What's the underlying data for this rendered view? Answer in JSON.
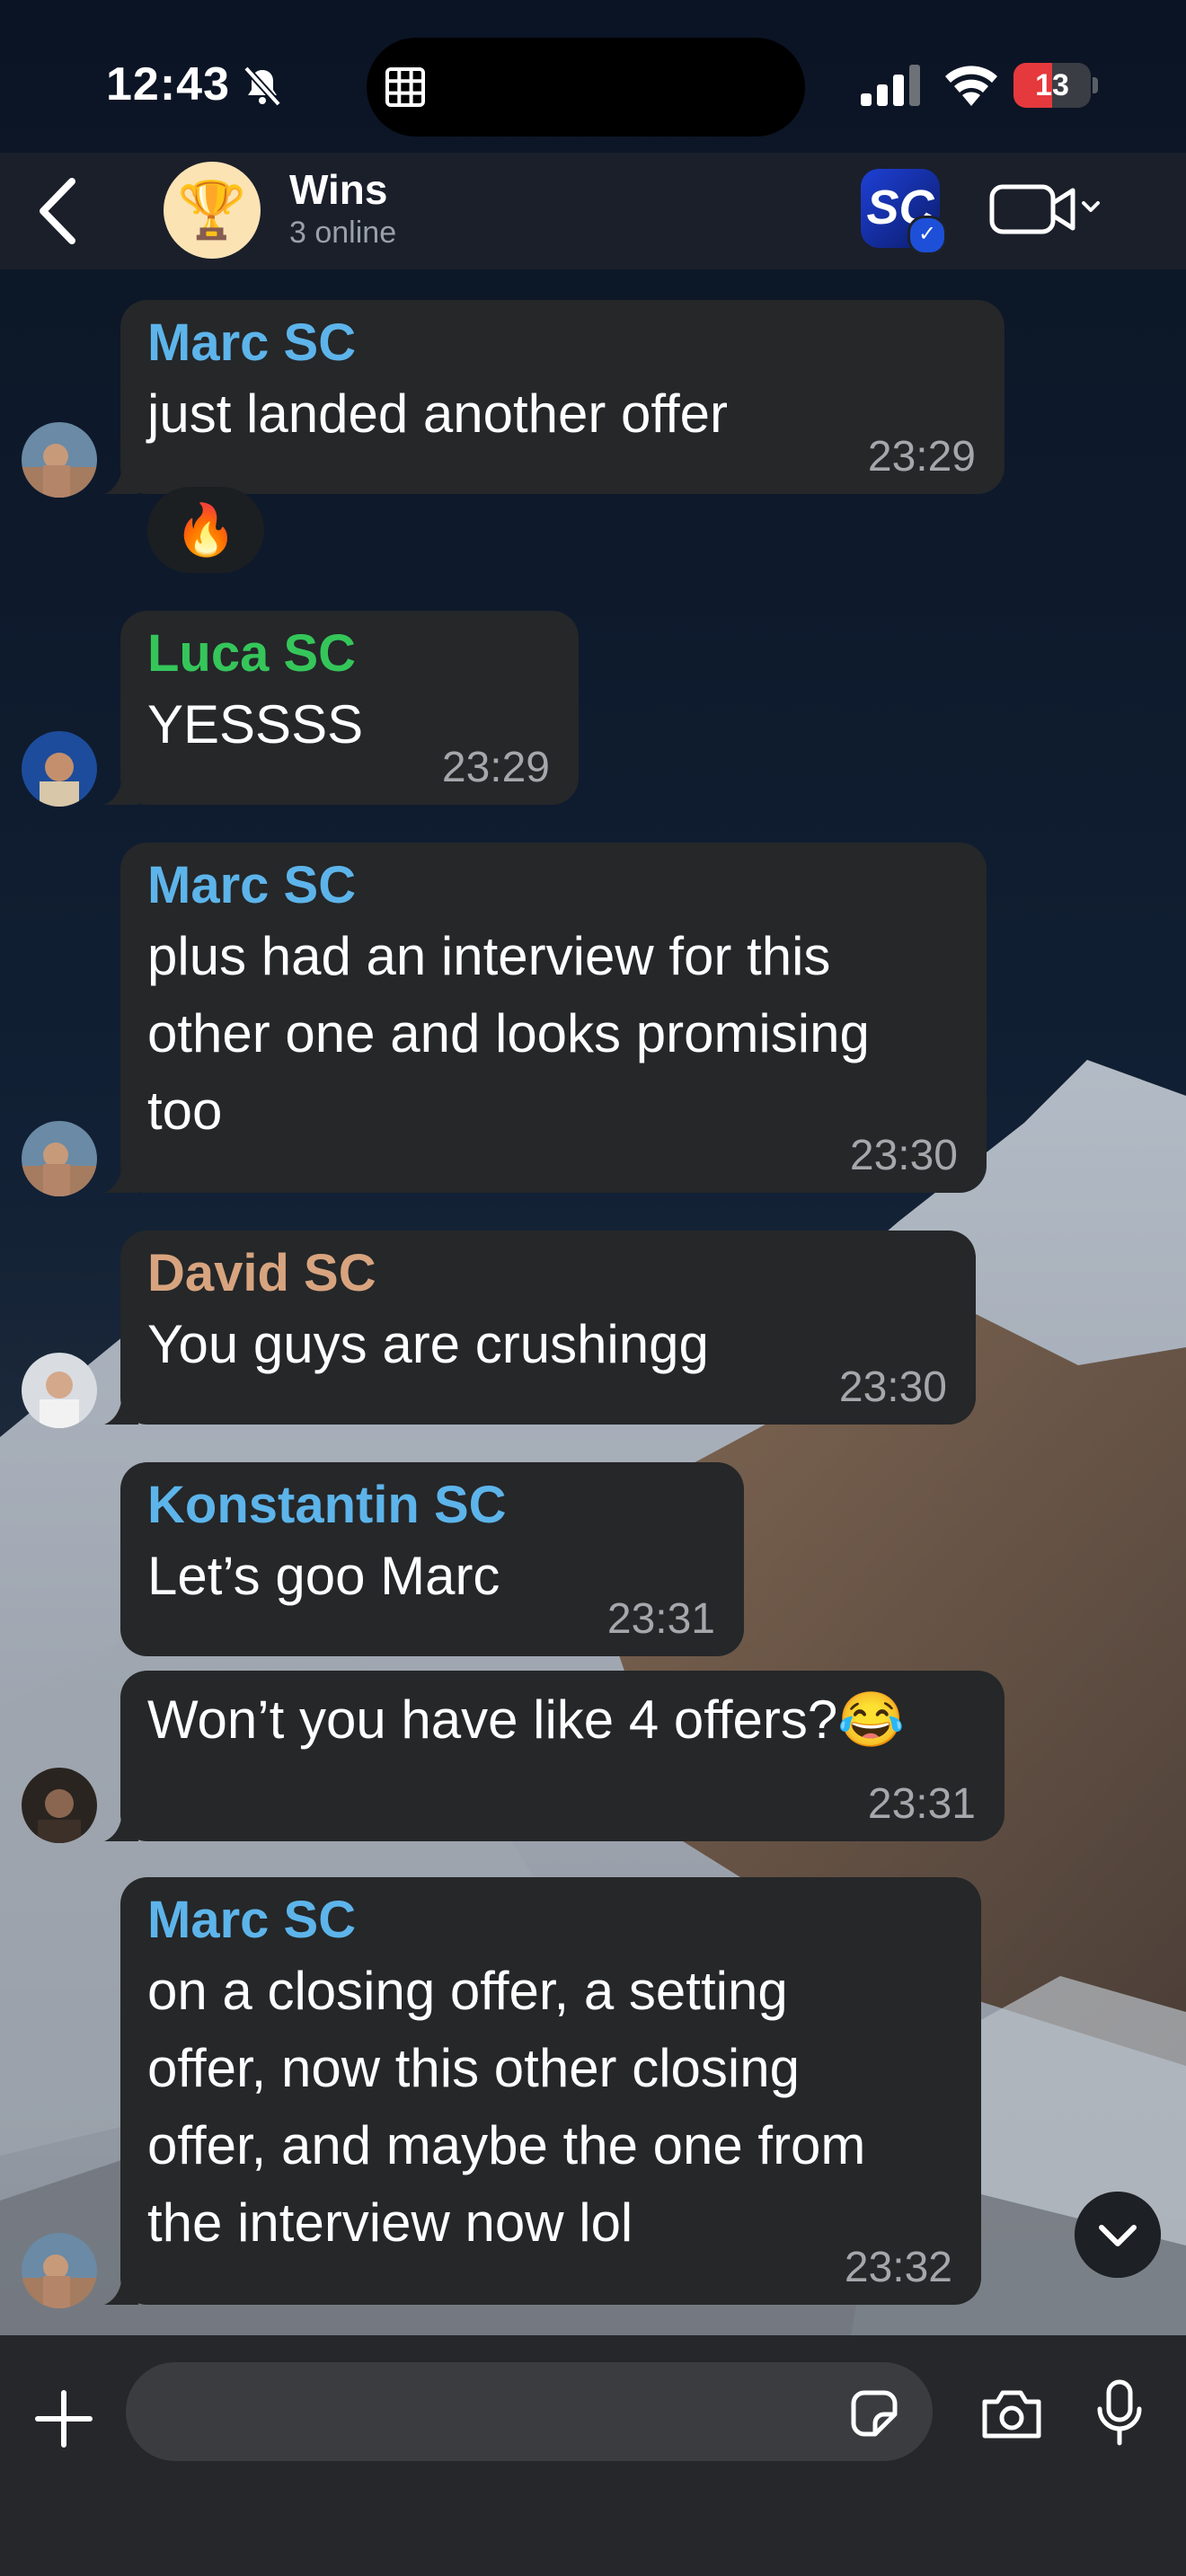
{
  "status_bar": {
    "time": "12:43",
    "battery": "13",
    "battery_level": 0.13
  },
  "header": {
    "back_icon": "chevron-left-icon",
    "group_icon": "🏆",
    "group_name": "Wins",
    "subtitle": "3 online",
    "app_logo_text": "SC",
    "video_icon": "video-camera-icon"
  },
  "colors": {
    "bubble": "#252729",
    "name_blue": "#5db4ea",
    "name_green": "#35c65a",
    "name_tan": "#d8a47f",
    "timestamp": "#a4a7ab"
  },
  "messages": [
    {
      "sender": "Marc SC",
      "lines": [
        "just landed another offer"
      ],
      "time": "23:29",
      "reaction": "🔥"
    },
    {
      "sender": "Luca SC",
      "lines": [
        "YESSSS"
      ],
      "time": "23:29"
    },
    {
      "sender": "Marc SC",
      "lines": [
        "plus had an interview for this",
        "other one and looks promising",
        "too"
      ],
      "time": "23:30"
    },
    {
      "sender": "David SC",
      "lines": [
        "You guys are crushingg"
      ],
      "time": "23:30"
    },
    {
      "sender": "Konstantin SC",
      "lines": [
        "Let’s goo Marc"
      ],
      "time": "23:31"
    },
    {
      "sender": "",
      "lines": [
        "Won’t you have like 4 offers?😂"
      ],
      "time": "23:31"
    },
    {
      "sender": "Marc SC",
      "lines": [
        "on a closing offer, a setting",
        "offer, now this other closing",
        "offer, and maybe the one from",
        "the interview now lol"
      ],
      "time": "23:32"
    }
  ],
  "composer": {
    "placeholder": ""
  }
}
